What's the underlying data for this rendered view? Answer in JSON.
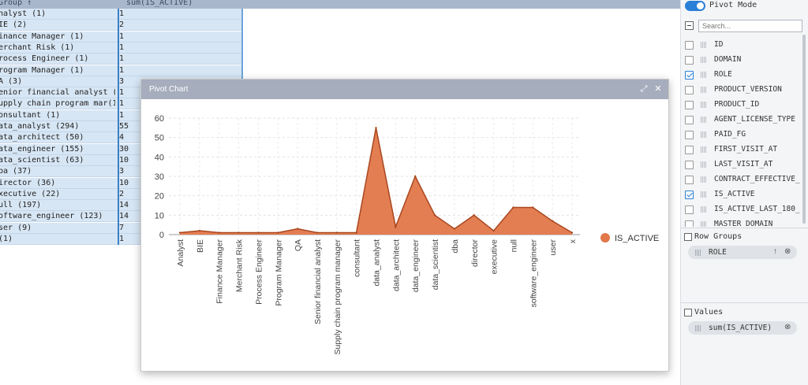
{
  "grid": {
    "header": {
      "group": "Group ↑",
      "value": "sum(IS_ACTIVE)"
    },
    "rows": [
      {
        "group": "nalyst (1)",
        "value": "1"
      },
      {
        "group": "IE (2)",
        "value": "2"
      },
      {
        "group": "inance Manager (1)",
        "value": "1"
      },
      {
        "group": "erchant Risk (1)",
        "value": "1"
      },
      {
        "group": "rocess Engineer (1)",
        "value": "1"
      },
      {
        "group": "rogram Manager (1)",
        "value": "1"
      },
      {
        "group": "A (3)",
        "value": "3"
      },
      {
        "group": "enior financial analyst (1)",
        "value": "1"
      },
      {
        "group": "upply chain program mar(1)",
        "value": "1"
      },
      {
        "group": "onsultant (1)",
        "value": "1"
      },
      {
        "group": "ata_analyst (294)",
        "value": "55"
      },
      {
        "group": "ata_architect (50)",
        "value": "4"
      },
      {
        "group": "ata_engineer (155)",
        "value": "30"
      },
      {
        "group": "ata_scientist (63)",
        "value": "10"
      },
      {
        "group": "ba (37)",
        "value": "3"
      },
      {
        "group": "irector (36)",
        "value": "10"
      },
      {
        "group": "xecutive (22)",
        "value": "2"
      },
      {
        "group": "ull (197)",
        "value": "14"
      },
      {
        "group": "oftware_engineer (123)",
        "value": "14"
      },
      {
        "group": "ser (9)",
        "value": "7"
      },
      {
        "group": " (1)",
        "value": "1"
      }
    ]
  },
  "dialog": {
    "title": "Pivot Chart",
    "expand_icon": "⤢",
    "close_icon": "✕"
  },
  "chart_data": {
    "type": "area",
    "categories": [
      "Analyst",
      "BIE",
      "Finance Manager",
      "Merchant Risk",
      "Process Engineer",
      "Program Manager",
      "QA",
      "Senior financial analyst",
      "Supply chain program manager",
      "consultant",
      "data_analyst",
      "data_architect",
      "data_engineer",
      "data_scientist",
      "dba",
      "director",
      "executive",
      "null",
      "software_engineer",
      "user",
      "x"
    ],
    "series": [
      {
        "name": "IS_ACTIVE",
        "values": [
          1,
          2,
          1,
          1,
          1,
          1,
          3,
          1,
          1,
          1,
          55,
          4,
          30,
          10,
          3,
          10,
          2,
          14,
          14,
          7,
          1
        ]
      }
    ],
    "ylim": [
      0,
      60
    ],
    "yticks": [
      0,
      10,
      20,
      30,
      40,
      50,
      60
    ],
    "grid": true,
    "legend": "right",
    "color": "#e2774a",
    "line_color": "#a9471f"
  },
  "panel": {
    "pivot_mode": "Pivot Mode",
    "search_placeholder": "Search...",
    "fields": [
      {
        "label": "ID",
        "checked": false
      },
      {
        "label": "DOMAIN",
        "checked": false
      },
      {
        "label": "ROLE",
        "checked": true
      },
      {
        "label": "PRODUCT_VERSION",
        "checked": false
      },
      {
        "label": "PRODUCT_ID",
        "checked": false
      },
      {
        "label": "AGENT_LICENSE_TYPE",
        "checked": false
      },
      {
        "label": "PAID_FG",
        "checked": false
      },
      {
        "label": "FIRST_VISIT_AT",
        "checked": false
      },
      {
        "label": "LAST_VISIT_AT",
        "checked": false
      },
      {
        "label": "CONTRACT_EFFECTIVE_",
        "checked": false
      },
      {
        "label": "IS_ACTIVE",
        "checked": true
      },
      {
        "label": "IS_ACTIVE_LAST_180_",
        "checked": false
      },
      {
        "label": "MASTER_DOMAIN",
        "checked": false
      }
    ],
    "row_groups_label": "Row Groups",
    "row_group_pill": "ROLE",
    "sort_icon": "↑",
    "remove_icon": "⊗",
    "values_label": "Values",
    "values_pill": "sum(IS_ACTIVE)"
  }
}
